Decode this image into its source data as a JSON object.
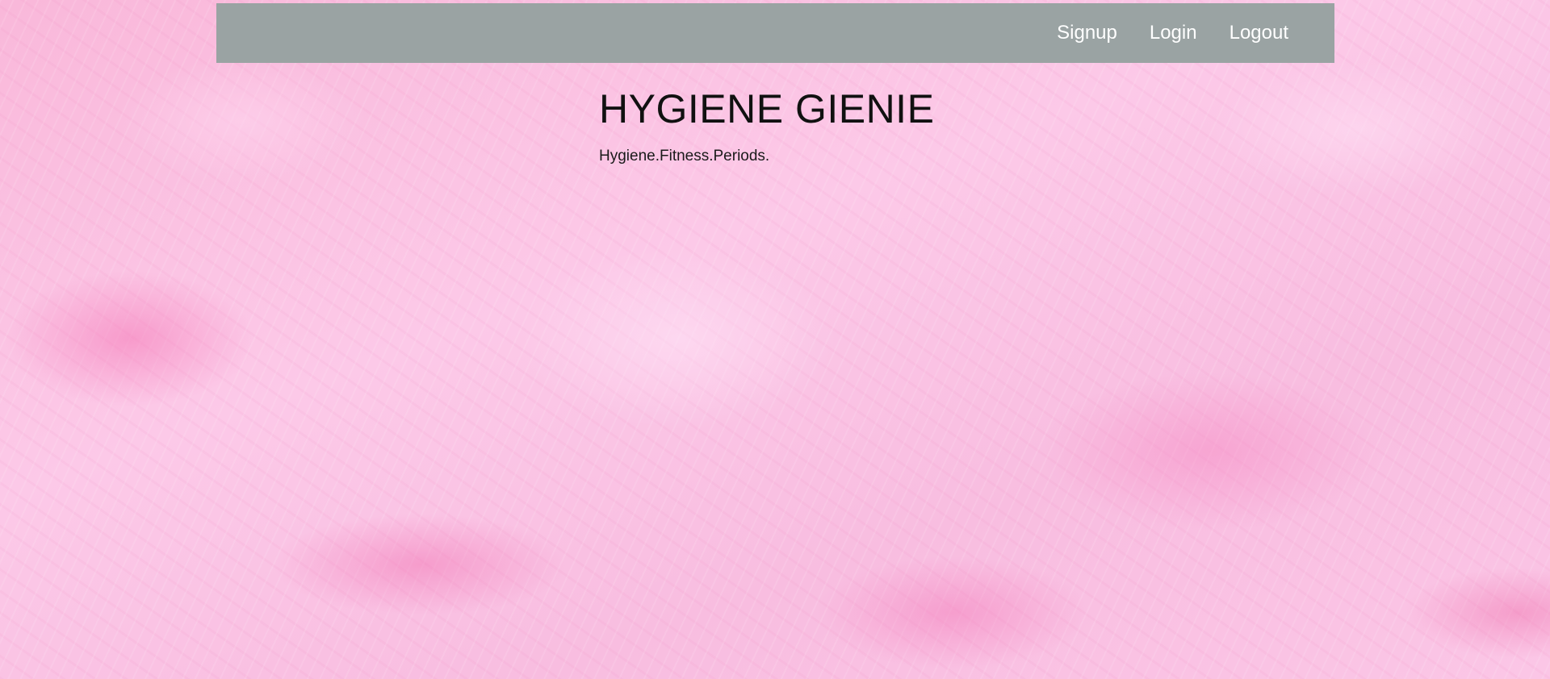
{
  "nav": {
    "links": [
      "Signup",
      "Login",
      "Logout"
    ]
  },
  "hero": {
    "title": "HYGIENE GIENIE",
    "tagline": "Hygiene.Fitness.Periods."
  },
  "colors": {
    "navbar_bg": "#9aa3a3",
    "background": "#fbc3e3",
    "nav_text": "#ffffff",
    "title_text": "#111111"
  }
}
